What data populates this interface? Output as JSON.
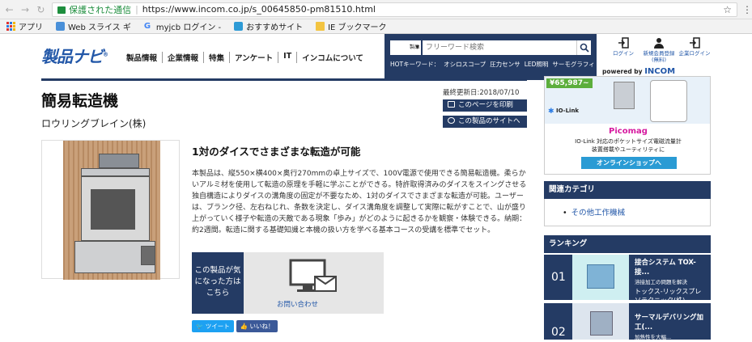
{
  "browser": {
    "secure_label": "保護された通信",
    "url": "https://www.incom.co.jp/s_00645850-pm81510.html"
  },
  "bookmarks": [
    {
      "label": "アプリ"
    },
    {
      "label": "Web スライス ギ"
    },
    {
      "label": "myjcb ログイン -"
    },
    {
      "label": "おすすめサイト"
    },
    {
      "label": "IE ブックマーク"
    }
  ],
  "header": {
    "logo": "製品ナビ",
    "nav": [
      "製品情報",
      "企業情報",
      "特集",
      "アンケート",
      "IT",
      "インコムについて"
    ],
    "search": {
      "select": "製品",
      "placeholder": "フリーワード検索",
      "hot_label": "HOTキーワード：",
      "hot": [
        "オシロスコープ",
        "圧力センサ",
        "LED照明",
        "サーモグラフィ"
      ]
    },
    "user": [
      {
        "label": "ログイン"
      },
      {
        "label": "新規会員登録(無料)"
      },
      {
        "label": "企業ログイン"
      }
    ],
    "powered": "powered by",
    "powered_brand": "INCOM"
  },
  "product": {
    "title": "簡易転造機",
    "maker": "ロウリングブレイン(株)",
    "updated": "最終更新日:2018/07/10",
    "print": "このページを印刷",
    "site": "この製品のサイトへ",
    "headline": "1対のダイスでさまざまな転造が可能",
    "description": "本製品は、縦550×横400×奥行270mmの卓上サイズで、100V電源で使用できる簡易転造機。柔らかいアルミ材を使用して転造の原理を手軽に学ぶことができる。特許取得済みのダイスをスイングさせる独自構造によりダイスの溝角度の固定が不要なため、1対のダイスでさまざまな転造が可能。ユーザーは、ブランク径、左右ねじれ、条数を決定し、ダイス溝角度を調整して実際に転がすことで、山が盛り上がっていく様子や転造の天敵である現象「歩み」がどのように起きるかを観察・体験できる。納期：約2週間。転造に関する基礎知識と本機の扱い方を学べる基本コースの受講を標準でセット。",
    "inquiry_label": "この製品が気になった方はこちら",
    "inquiry_link": "お問い合わせ",
    "tweet": "ツイート",
    "like": "いいね！"
  },
  "ad": {
    "price": "¥65,987~",
    "iolink": "IO-Link",
    "brand": "Picomag",
    "text1": "IO-Link 対応のポケットサイズ電磁流量計",
    "text2": "装置搭載やユーティリティに",
    "button": "オンラインショップへ"
  },
  "sidebar": {
    "cat_title": "関連カテゴリ",
    "cat_item": "その他工作機械",
    "rank_title": "ランキング",
    "ranks": [
      {
        "num": "01",
        "name": "接合システム TOX-接...",
        "sub": "溶接加工の問題を解決",
        "company": "トックス-リックスプレソテクニック(株)"
      },
      {
        "num": "02",
        "name": "サーマルデバリング加工(...",
        "sub": "加熱性を大幅..."
      }
    ]
  }
}
